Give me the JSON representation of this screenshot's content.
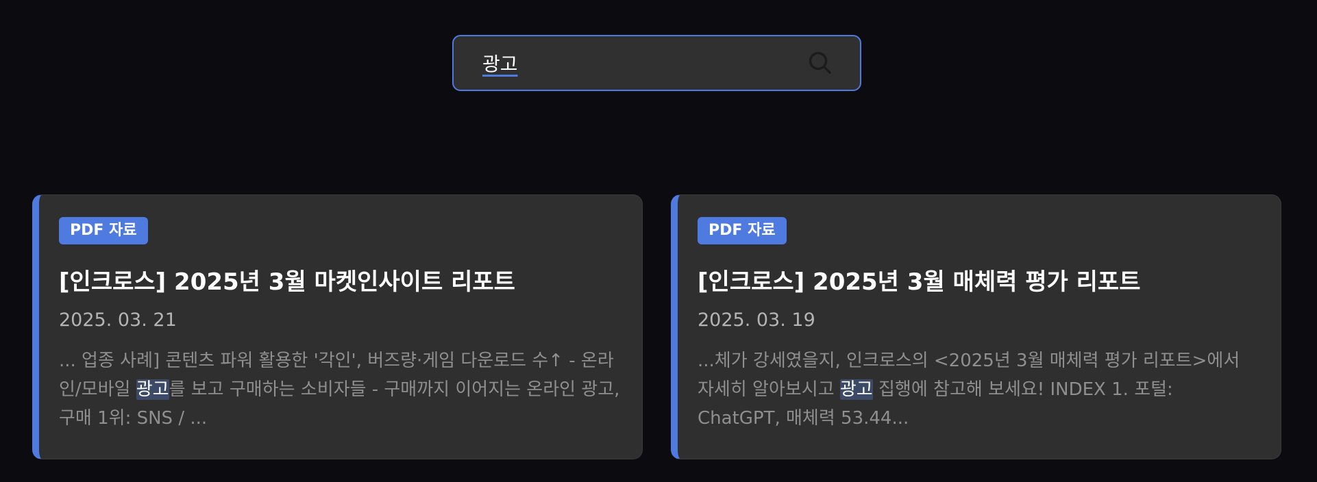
{
  "search": {
    "value": "광고"
  },
  "colors": {
    "accent": "#4f7be0",
    "background": "#0b0b10",
    "card": "#2f2f2f"
  },
  "results": [
    {
      "badge": "PDF 자료",
      "title": "[인크로스] 2025년 3월 마켓인사이트 리포트",
      "date": "2025. 03. 21",
      "excerpt_before": "... 업종 사례] 콘텐츠 파워 활용한 '각인', 버즈량·게임 다운로드 수↑ - 온라인/모바일 ",
      "excerpt_highlight": "광고",
      "excerpt_after": "를 보고 구매하는 소비자들 - 구매까지 이어지는 온라인 광고, 구매 1위: SNS / ..."
    },
    {
      "badge": "PDF 자료",
      "title": "[인크로스] 2025년 3월 매체력 평가 리포트",
      "date": "2025. 03. 19",
      "excerpt_before": "...체가 강세였을지, 인크로스의 <2025년 3월 매체력 평가 리포트>에서 자세히 알아보시고 ",
      "excerpt_highlight": "광고",
      "excerpt_after": " 집행에 참고해 보세요! INDEX 1. 포털: ChatGPT, 매체력 53.44..."
    }
  ]
}
